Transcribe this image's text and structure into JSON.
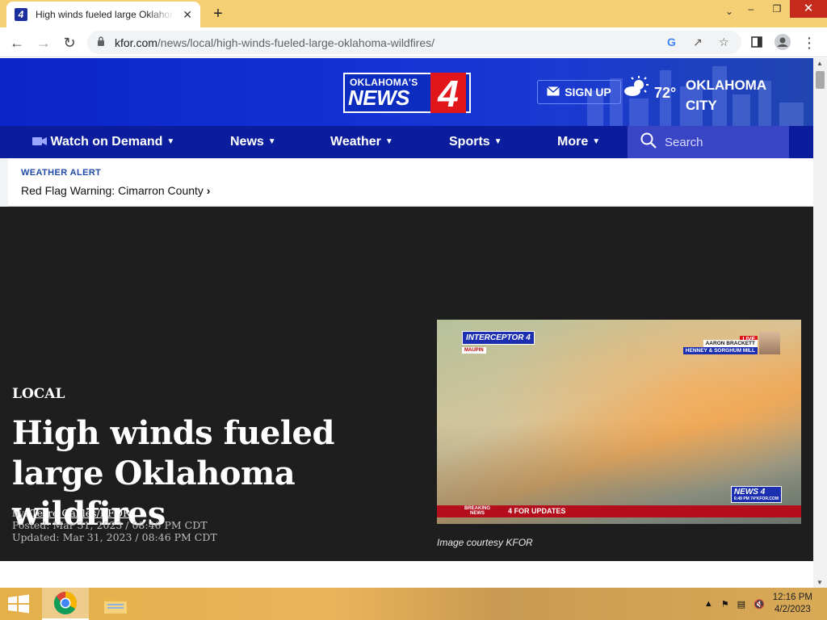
{
  "browser": {
    "tab_title": "High winds fueled large Oklahoma wildfires",
    "tab_close": "✕",
    "new_tab": "+",
    "url_host": "kfor.com",
    "url_path": "/news/local/high-winds-fueled-large-oklahoma-wildfires/",
    "favicon": "4"
  },
  "header": {
    "logo_line1": "OKLAHOMA'S",
    "logo_line2": "NEWS",
    "logo_number": "4",
    "signup_label": "SIGN UP",
    "temperature": "72°",
    "city": "OKLAHOMA CITY"
  },
  "nav": {
    "items": [
      {
        "label": "Watch on Demand"
      },
      {
        "label": "News"
      },
      {
        "label": "Weather"
      },
      {
        "label": "Sports"
      },
      {
        "label": "More"
      }
    ],
    "search_placeholder": "Search"
  },
  "alert": {
    "label": "WEATHER ALERT",
    "text": "Red Flag Warning: Cimarron County",
    "chevron": "›"
  },
  "article": {
    "category": "LOCAL",
    "headline": "High winds fueled large Oklahoma wildfires",
    "by_prefix": "by: ",
    "author": "Terré Gables/KFOR",
    "posted": "Posted: Mar 31, 2023 / 08:46 PM CDT",
    "updated": "Updated: Mar 31, 2023 / 08:46 PM CDT",
    "caption": "Image courtesy KFOR"
  },
  "video": {
    "interceptor": "INTERCEPTOR 4",
    "maupin": "MAUPIN",
    "live": "LIVE",
    "reporter": "AARON BRACKETT",
    "location": "HENNEY & SORGHUM MILL",
    "breaking": "BREAKING NEWS",
    "ticker_text": "4 FOR UPDATES",
    "corner_logo": "NEWS 4",
    "corner_small": "6:49 PM  74°KFOR.COM"
  },
  "taskbar": {
    "time": "12:16 PM",
    "date": "4/2/2023"
  },
  "colors": {
    "header_blue": "#0a25c8",
    "nav_blue": "#0b1d9c",
    "logo_red": "#e0161b",
    "alert_label": "#1f4aa8",
    "hero_bg": "#1e1e1e"
  }
}
